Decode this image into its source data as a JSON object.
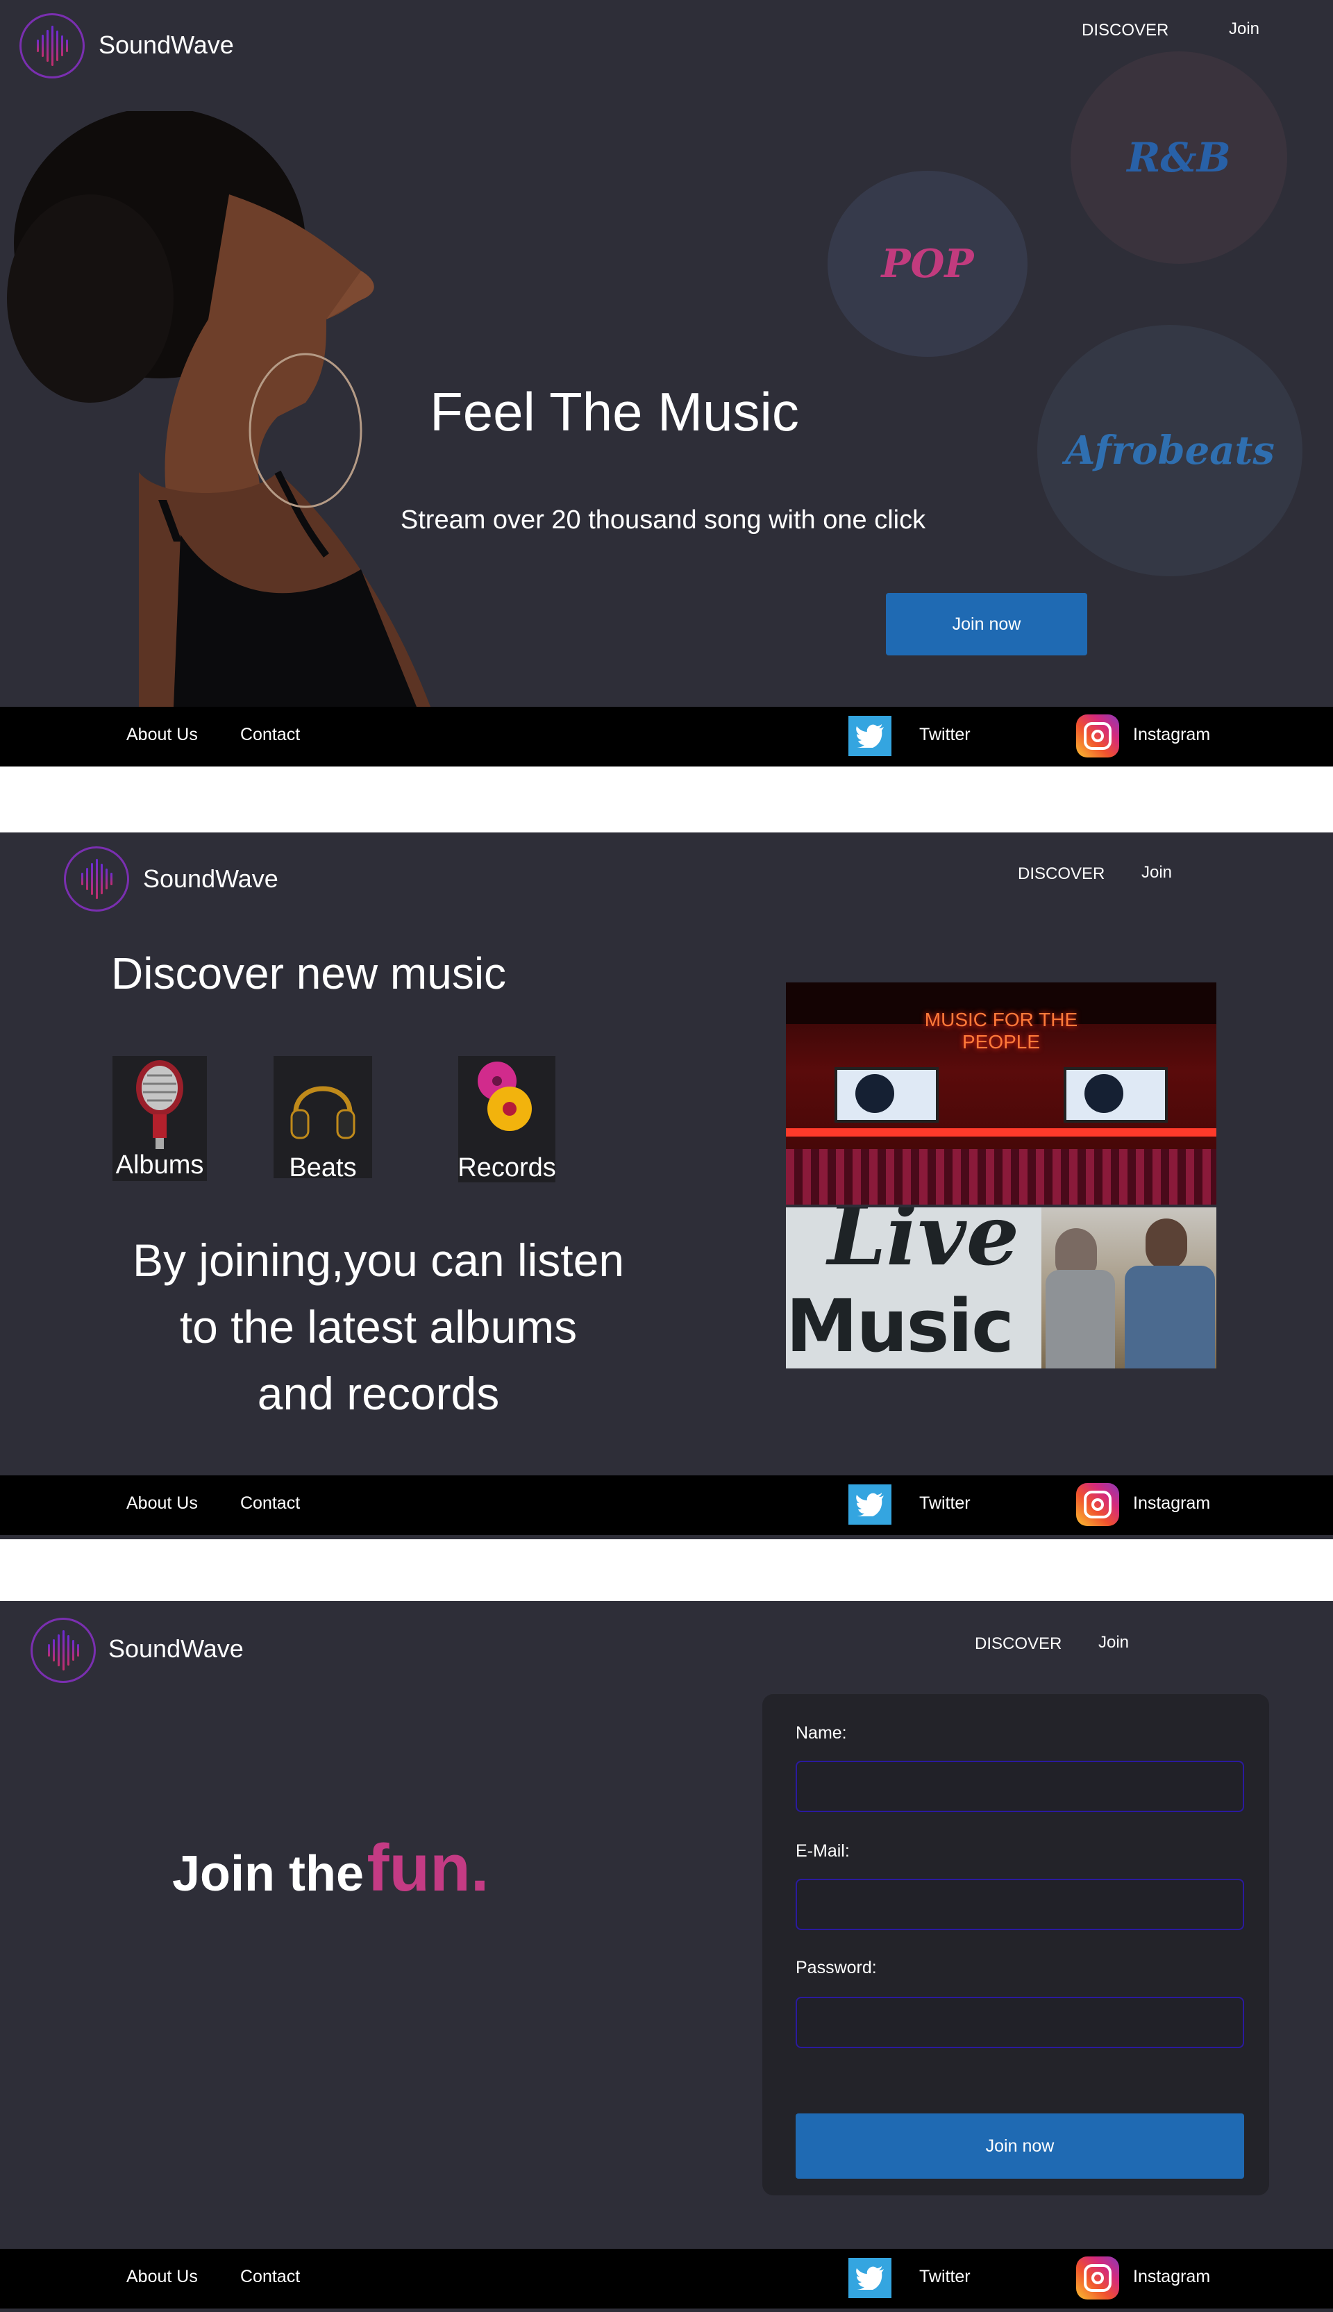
{
  "brand": {
    "name": "SoundWave"
  },
  "nav": {
    "discover": "DISCOVER",
    "join": "Join"
  },
  "footer": {
    "about": "About Us",
    "contact": "Contact",
    "twitter": "Twitter",
    "instagram": "Instagram"
  },
  "hero": {
    "title": "Feel The Music",
    "subtitle": "Stream over 20 thousand song with one click",
    "cta": "Join now",
    "genres": [
      "POP",
      "R&B",
      "Afrobeats"
    ]
  },
  "discover": {
    "title": "Discover new music",
    "categories": [
      {
        "label": "Albums",
        "icon": "microphone-icon"
      },
      {
        "label": "Beats",
        "icon": "headphones-icon"
      },
      {
        "label": "Records",
        "icon": "vinyl-records-icon"
      }
    ],
    "pitch_line1": "By joining,you can listen",
    "pitch_line2": "to the latest albums",
    "pitch_line3": "and records",
    "photo_neon_text": "MUSIC FOR THE PEOPLE",
    "photo_sign_text": "Live",
    "photo_sign_text2": "Music"
  },
  "join": {
    "headline_part1": "Join the",
    "headline_part2": "fun.",
    "name_label": "Name:",
    "email_label": "E-Mail:",
    "password_label": "Password:",
    "name_value": "",
    "email_value": "",
    "password_value": "",
    "submit": "Join now"
  },
  "colors": {
    "background": "#2e2e38",
    "accent_pink": "#c43b84",
    "accent_blue": "#1f6ab3",
    "footer": "#000000"
  }
}
